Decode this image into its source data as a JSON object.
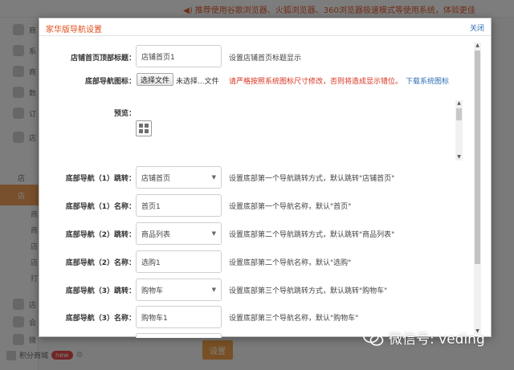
{
  "background": {
    "notice": "◀) 推荐使用谷歌浏览器、火狐浏览器、360浏览器极速模式等使用系统，体验更佳",
    "sidebar_labels": [
      "商",
      "系",
      "商",
      "数",
      "订",
      "店",
      "店",
      "店"
    ],
    "sidebar_subs": [
      "商",
      "商",
      "店",
      "店",
      "打"
    ],
    "sidebar_more": [
      "店",
      "会",
      "微"
    ],
    "points_label": "积分商城",
    "points_badge": "new",
    "save_label": "设置"
  },
  "dialog": {
    "title": "家华版导航设置",
    "close_label": "关闭",
    "shop_title": {
      "label": "店铺首页顶部标题：",
      "value": "店铺首页1",
      "hint": "设置店铺首页标题显示"
    },
    "bottom_icon": {
      "label": "底部导航图标：",
      "button_label": "选择文件",
      "file_status": "未选择...文件",
      "warning": "请严格按照系统图标尺寸修改，否则将造成显示错位。",
      "download_link": "下载系统图标"
    },
    "preview_label": "预览：",
    "nav_rows": [
      {
        "label": "底部导航（1）跳转：",
        "type": "select",
        "value": "店铺首页",
        "hint": "设置底部第一个导航跳转方式，默认跳转\"店铺首页\""
      },
      {
        "label": "底部导航（1）名称：",
        "type": "input",
        "value": "首页1",
        "hint": "设置底部第一个导航名称，默认\"首页\""
      },
      {
        "label": "底部导航（2）跳转：",
        "type": "select",
        "value": "商品列表",
        "hint": "设置底部第二个导航跳转方式，默认跳转\"商品列表\""
      },
      {
        "label": "底部导航（2）名称：",
        "type": "input",
        "value": "选购1",
        "hint": "设置底部第二个导航名称，默认\"选购\""
      },
      {
        "label": "底部导航（3）跳转：",
        "type": "select",
        "value": "购物车",
        "hint": "设置底部第三个导航跳转方式，默认跳转\"购物车\""
      },
      {
        "label": "底部导航（3）名称：",
        "type": "input",
        "value": "购物车1",
        "hint": "设置底部第三个导航名称，默认\"购物车\""
      }
    ]
  },
  "watermark": "微信号: veding",
  "colors": {
    "title_orange": "#e04c18",
    "warning_red": "#d8321f",
    "link_blue": "#2d6fb5",
    "accent_orange": "#f0a04b"
  }
}
